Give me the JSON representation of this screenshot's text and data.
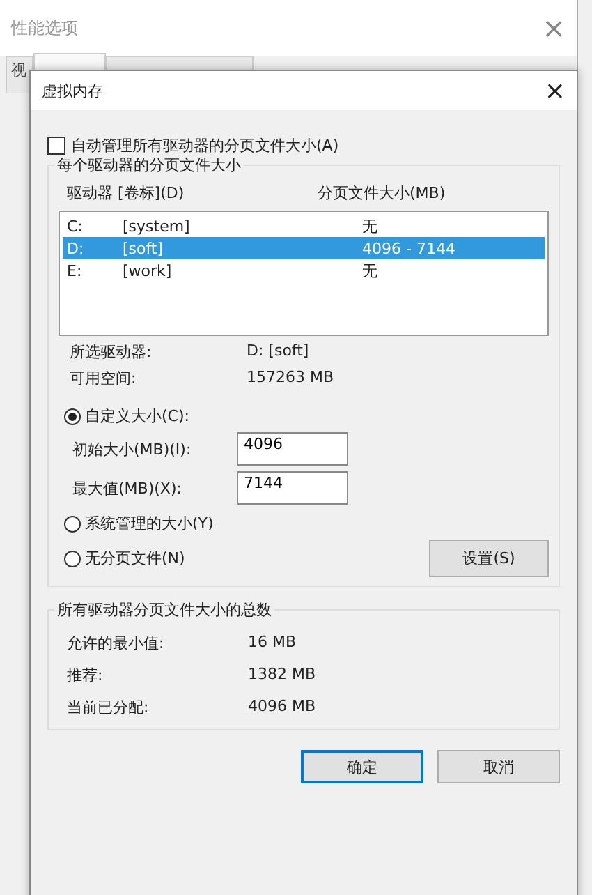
{
  "back_window": {
    "title": "性能选项",
    "close": "×",
    "tabs": [
      {
        "label": "视",
        "selected": false
      },
      {
        "selected": true
      },
      {
        "selected": false
      }
    ]
  },
  "dialog": {
    "title": "虚拟内存",
    "close": "×",
    "auto_manage": {
      "label": "自动管理所有驱动器的分页文件大小(A)",
      "checked": false
    },
    "per_drive": {
      "legend": "每个驱动器的分页文件大小",
      "columns": [
        "驱动器 [卷标](D)",
        "分页文件大小(MB)"
      ],
      "rows": [
        {
          "drive": "C:",
          "label": "[system]",
          "size": "无",
          "selected": false
        },
        {
          "drive": "D:",
          "label": "[soft]",
          "size": "4096 - 7144",
          "selected": true
        },
        {
          "drive": "E:",
          "label": "[work]",
          "size": "无",
          "selected": false
        }
      ],
      "info": [
        {
          "label": "所选驱动器:",
          "value": "D:  [soft]"
        },
        {
          "label": "可用空间:",
          "value": "157263 MB"
        }
      ],
      "options": [
        {
          "label": "自定义大小(C):",
          "selected": true
        },
        {
          "label": "系统管理的大小(Y)",
          "selected": false
        },
        {
          "label": "无分页文件(N)",
          "selected": false
        }
      ],
      "fields": [
        {
          "label": "初始大小(MB)(I):",
          "value": "4096"
        },
        {
          "label": "最大值(MB)(X):",
          "value": "7144"
        }
      ],
      "set_button": "设置(S)"
    },
    "totals": {
      "legend": "所有驱动器分页文件大小的总数",
      "rows": [
        {
          "label": "允许的最小值:",
          "value": "16 MB"
        },
        {
          "label": "推荐:",
          "value": "1382 MB"
        },
        {
          "label": "当前已分配:",
          "value": "4096 MB"
        }
      ]
    },
    "buttons": [
      {
        "label": "确定",
        "default": true
      },
      {
        "label": "取消",
        "default": false
      }
    ]
  }
}
